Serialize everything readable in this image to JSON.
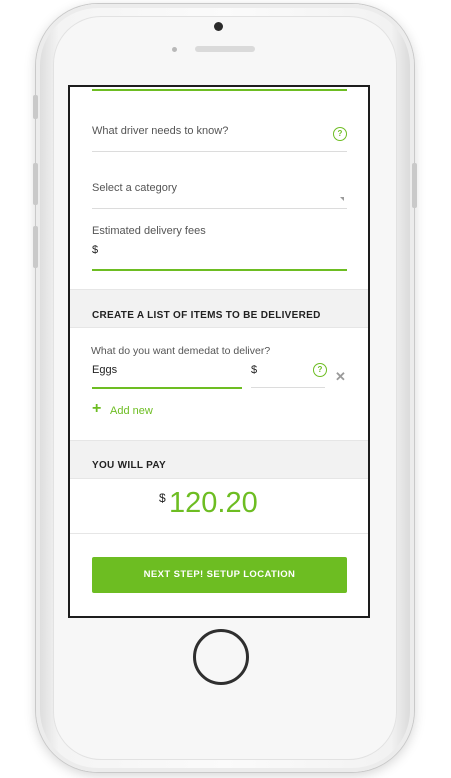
{
  "form": {
    "driver_note_placeholder": "What driver needs to know?",
    "category_placeholder": "Select a category",
    "delivery_fees_label": "Estimated delivery fees",
    "delivery_fees_currency": "$"
  },
  "items_section": {
    "heading": "CREATE A LIST OF ITEMS TO BE DELIVERED",
    "question": "What do you want demedat to deliver?",
    "item_name": "Eggs",
    "item_price_currency": "$",
    "help_glyph": "?",
    "remove_glyph": "✕",
    "add_new_label": "Add new",
    "add_new_glyph": "+"
  },
  "pay_section": {
    "heading": "YOU WILL PAY",
    "currency": "$",
    "amount": "120.20"
  },
  "next_button": {
    "label": "NEXT STEP! SETUP LOCATION"
  },
  "colors": {
    "accent": "#6dbd22",
    "section_bg": "#f2f2f2",
    "text": "#222222"
  },
  "icons": [
    "help-icon",
    "remove-icon",
    "plus-icon",
    "select-arrow-icon"
  ]
}
